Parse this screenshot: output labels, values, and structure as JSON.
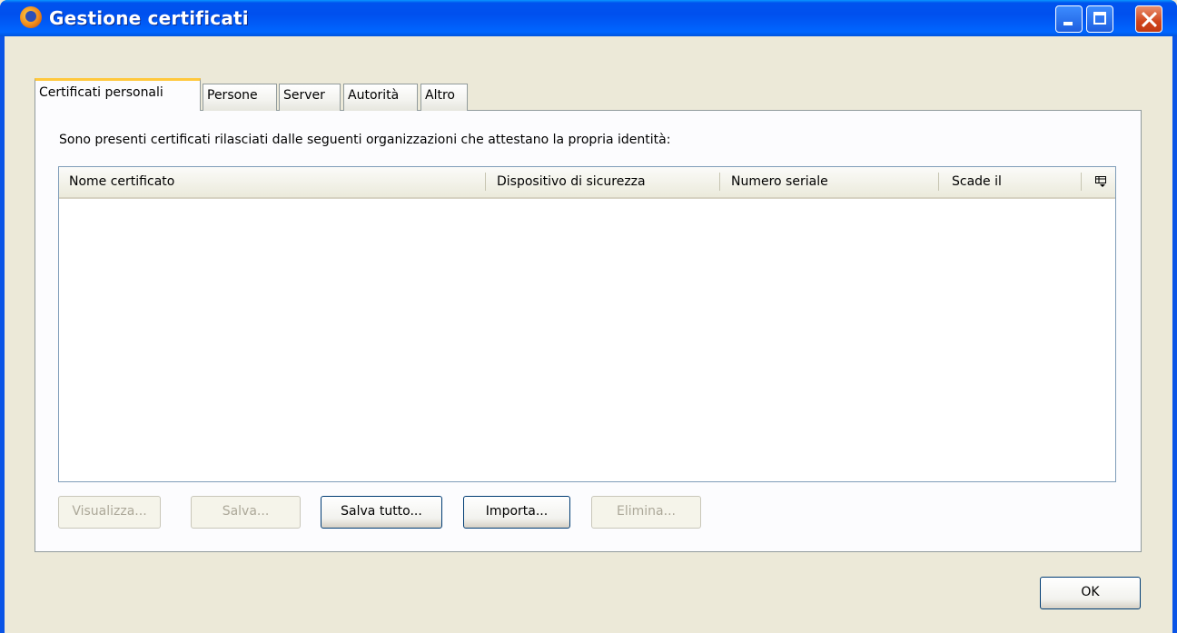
{
  "window": {
    "title": "Gestione certificati",
    "app_icon": "firefox-icon",
    "controls": [
      "minimize-icon",
      "maximize-icon",
      "close-icon"
    ]
  },
  "tabs": [
    {
      "label": "Certificati personali",
      "active": true
    },
    {
      "label": "Persone",
      "active": false
    },
    {
      "label": "Server",
      "active": false
    },
    {
      "label": "Autorità",
      "active": false
    },
    {
      "label": "Altro",
      "active": false
    }
  ],
  "panel": {
    "description": "Sono presenti certificati rilasciati dalle seguenti organizzazioni che attestano la propria identità:",
    "columns": [
      "Nome certificato",
      "Dispositivo di sicurezza",
      "Numero seriale",
      "Scade il"
    ],
    "column_picker_icon": "column-picker-icon",
    "rows": []
  },
  "buttons": {
    "view": {
      "label": "Visualizza...",
      "enabled": false
    },
    "save": {
      "label": "Salva...",
      "enabled": false
    },
    "save_all": {
      "label": "Salva tutto...",
      "enabled": true
    },
    "import": {
      "label": "Importa...",
      "enabled": true
    },
    "delete": {
      "label": "Elimina...",
      "enabled": false
    }
  },
  "ok_label": "OK",
  "colors": {
    "titlebar": "#0058ee",
    "tab_highlight": "#ffc83c",
    "face": "#ece9d8"
  }
}
